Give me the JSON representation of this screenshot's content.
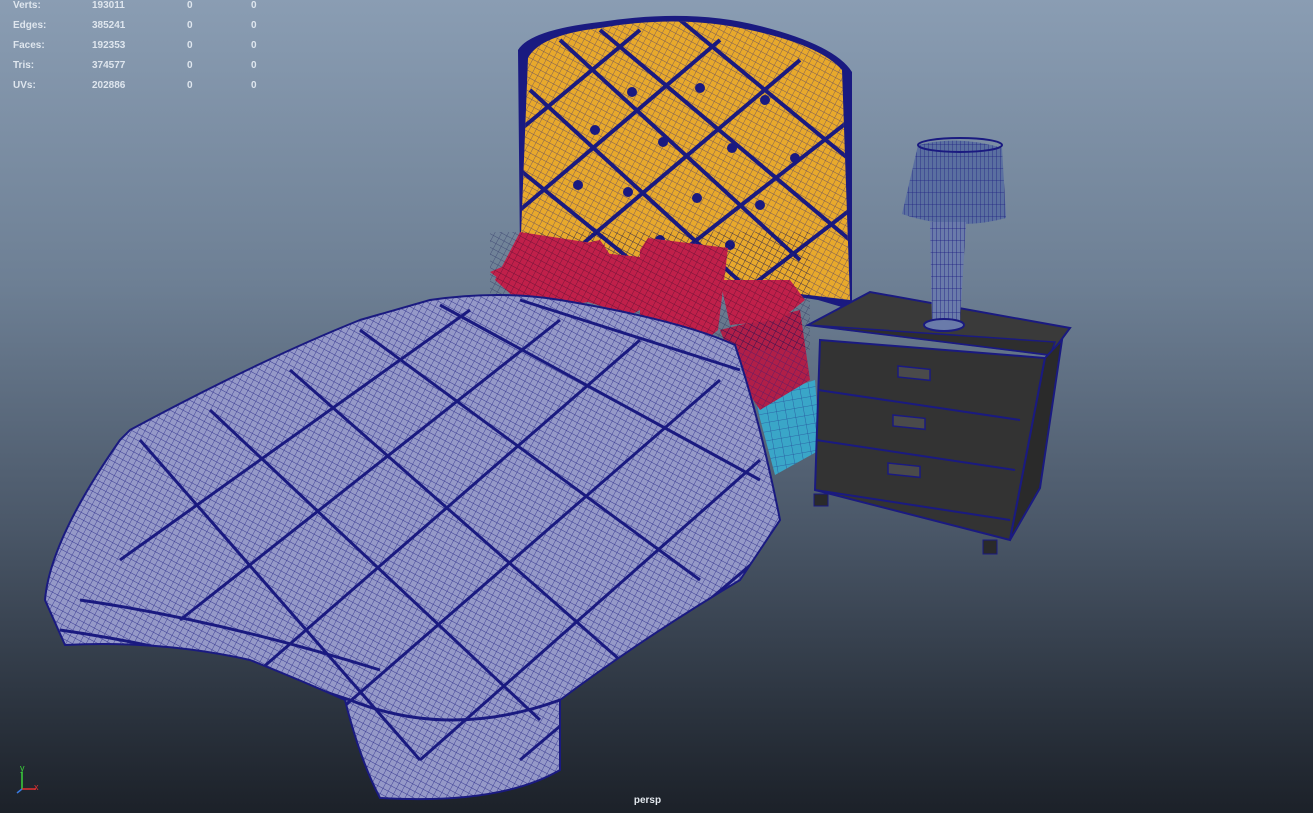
{
  "stats": [
    {
      "label": "Verts:",
      "v1": "193011",
      "v2": "0",
      "v3": "0"
    },
    {
      "label": "Edges:",
      "v1": "385241",
      "v2": "0",
      "v3": "0"
    },
    {
      "label": "Faces:",
      "v1": "192353",
      "v2": "0",
      "v3": "0"
    },
    {
      "label": "Tris:",
      "v1": "374577",
      "v2": "0",
      "v3": "0"
    },
    {
      "label": "UVs:",
      "v1": "202886",
      "v2": "0",
      "v3": "0"
    }
  ],
  "viewport": {
    "camera": "persp"
  },
  "axis": {
    "y": "y",
    "x": "x"
  },
  "colors": {
    "wire": "#1a1a80",
    "headboard": "#e8a92c",
    "pillow": "#c0204a",
    "comforter": "#8c90c4",
    "nightstand": "#3a3a3a",
    "bedbase": "#3aa6c8"
  }
}
